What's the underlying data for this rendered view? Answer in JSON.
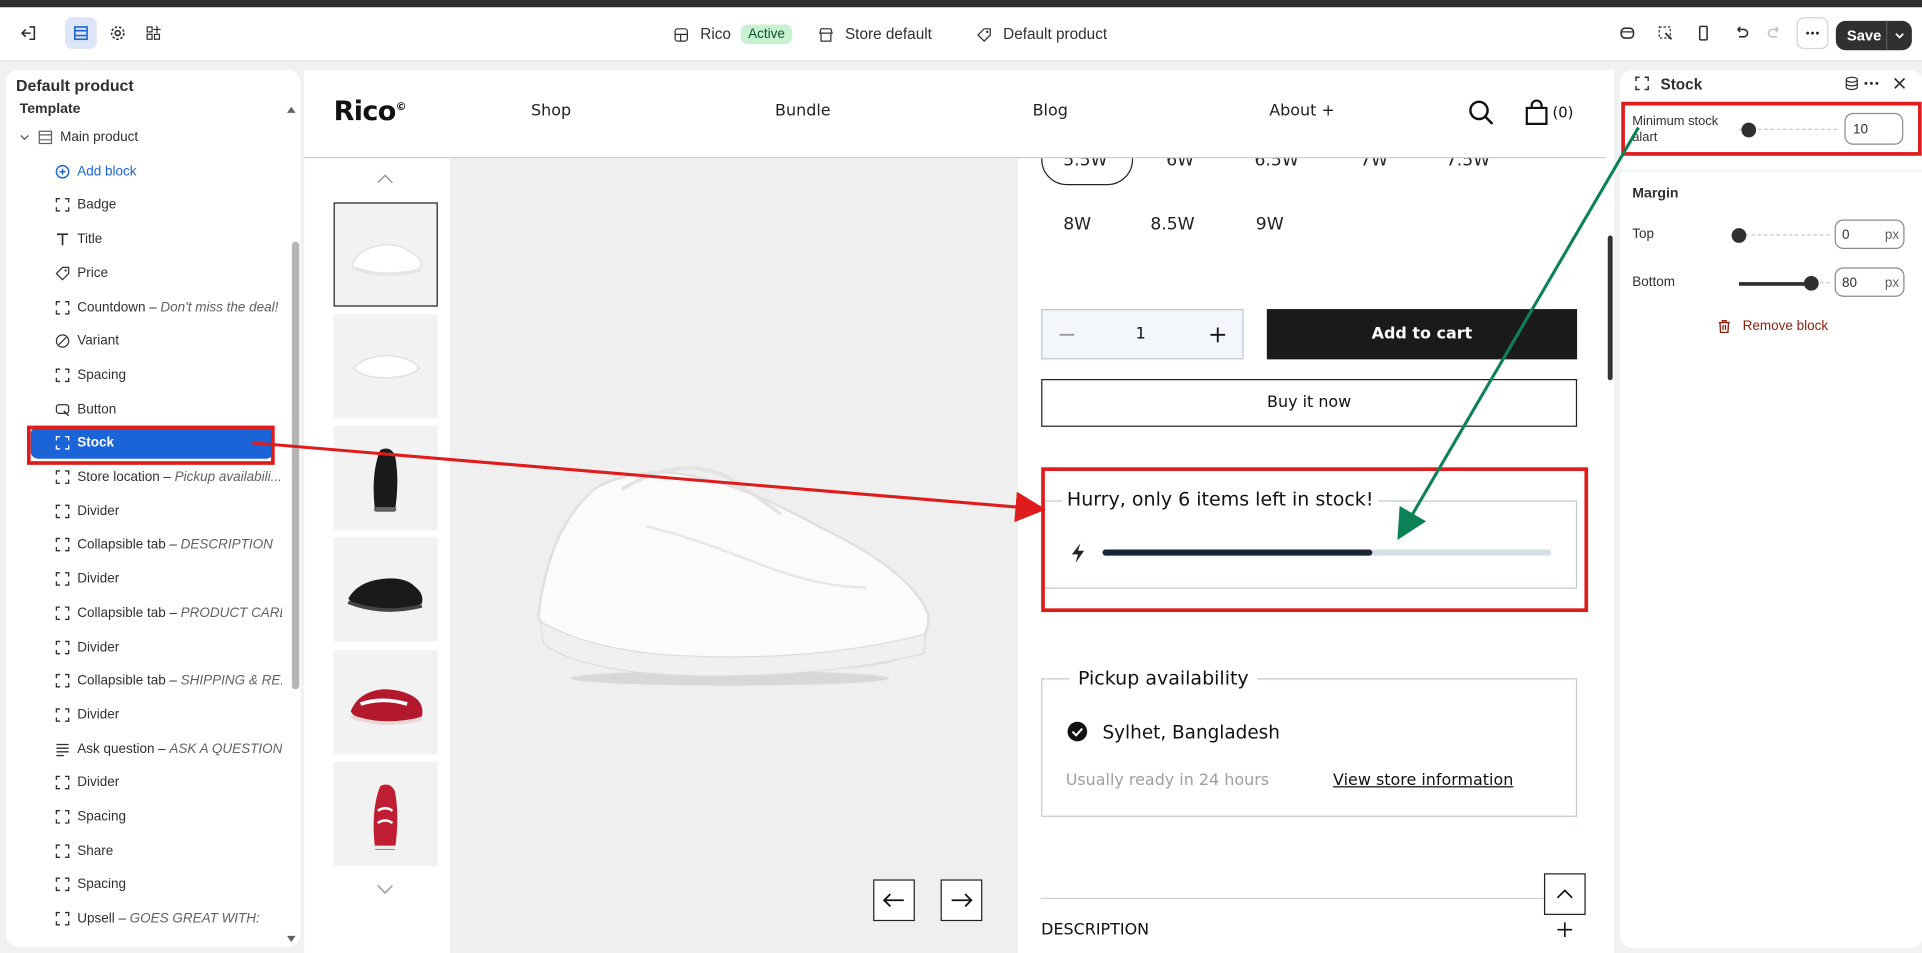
{
  "toolbar": {
    "theme_name": "Rico",
    "theme_status": "Active",
    "store": "Store default",
    "template": "Default product",
    "save": "Save"
  },
  "left_panel": {
    "title": "Default product",
    "section": "Template",
    "items": [
      {
        "label": "Main product",
        "sub": "",
        "icon": "section-icon"
      },
      {
        "label": "Add block",
        "sub": "",
        "icon": "plus-circle-icon"
      },
      {
        "label": "Badge",
        "sub": "",
        "icon": "block-icon"
      },
      {
        "label": "Title",
        "sub": "",
        "icon": "text-icon"
      },
      {
        "label": "Price",
        "sub": "",
        "icon": "price-tag-icon"
      },
      {
        "label": "Countdown",
        "sub": "Don't miss the deal!",
        "icon": "block-icon"
      },
      {
        "label": "Variant",
        "sub": "",
        "icon": "variant-icon"
      },
      {
        "label": "Spacing",
        "sub": "",
        "icon": "block-icon"
      },
      {
        "label": "Button",
        "sub": "",
        "icon": "button-icon"
      },
      {
        "label": "Stock",
        "sub": "",
        "icon": "block-icon"
      },
      {
        "label": "Store location",
        "sub": "Pickup availabili...",
        "icon": "block-icon"
      },
      {
        "label": "Divider",
        "sub": "",
        "icon": "block-icon"
      },
      {
        "label": "Collapsible tab",
        "sub": "DESCRIPTION",
        "icon": "block-icon"
      },
      {
        "label": "Divider",
        "sub": "",
        "icon": "block-icon"
      },
      {
        "label": "Collapsible tab",
        "sub": "PRODUCT CARE",
        "icon": "block-icon"
      },
      {
        "label": "Divider",
        "sub": "",
        "icon": "block-icon"
      },
      {
        "label": "Collapsible tab",
        "sub": "SHIPPING & RE...",
        "icon": "block-icon"
      },
      {
        "label": "Divider",
        "sub": "",
        "icon": "block-icon"
      },
      {
        "label": "Ask question",
        "sub": "ASK A QUESTION",
        "icon": "lines-icon"
      },
      {
        "label": "Divider",
        "sub": "",
        "icon": "block-icon"
      },
      {
        "label": "Spacing",
        "sub": "",
        "icon": "block-icon"
      },
      {
        "label": "Share",
        "sub": "",
        "icon": "block-icon"
      },
      {
        "label": "Spacing",
        "sub": "",
        "icon": "block-icon"
      },
      {
        "label": "Upsell",
        "sub": "GOES GREAT WITH:",
        "icon": "block-icon"
      }
    ]
  },
  "store": {
    "logo": "Rico",
    "logo_mark": "©",
    "nav": [
      "Shop",
      "Bundle",
      "Blog",
      "About +"
    ],
    "cart_count": "(0)",
    "sizes_row1": [
      "5.5W",
      "6W",
      "6.5W",
      "7W",
      "7.5W"
    ],
    "sizes_row2": [
      "8W",
      "8.5W",
      "9W"
    ],
    "quantity": "1",
    "add_to_cart": "Add to cart",
    "buy_now": "Buy it now",
    "stock_message": "Hurry, only 6 items left in stock!",
    "stock_fill": 0.6,
    "pickup_title": "Pickup availability",
    "pickup_location": "Sylhet, Bangladesh",
    "pickup_ready": "Usually ready in 24 hours",
    "pickup_link": "View store information",
    "description": "DESCRIPTION"
  },
  "settings": {
    "title": "Stock",
    "min_stock_label": "Minimum stock alart",
    "min_stock_value": "10",
    "min_stock_level": 0.1,
    "margin_title": "Margin",
    "top_label": "Top",
    "top_value": "0",
    "top_level": 0,
    "bottom_label": "Bottom",
    "bottom_value": "80",
    "bottom_level": 0.8,
    "unit": "px",
    "remove": "Remove block"
  },
  "colors": {
    "accent": "#1b64d8",
    "annotation_red": "#e01b1b",
    "annotation_green": "#0b8256",
    "danger": "#8e1f0b"
  }
}
